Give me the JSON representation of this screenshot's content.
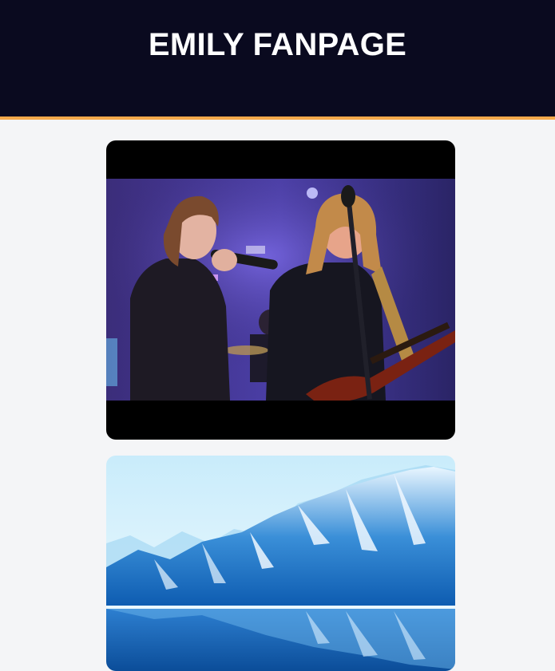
{
  "header": {
    "title": "EMILY FANPAGE",
    "accent_color": "#f6a94b",
    "background": "#0a0a1f"
  },
  "feed": {
    "items": [
      {
        "type": "video",
        "icon": "concert-video-thumbnail"
      },
      {
        "type": "image",
        "icon": "snowy-mountain-lake-photo"
      }
    ]
  }
}
